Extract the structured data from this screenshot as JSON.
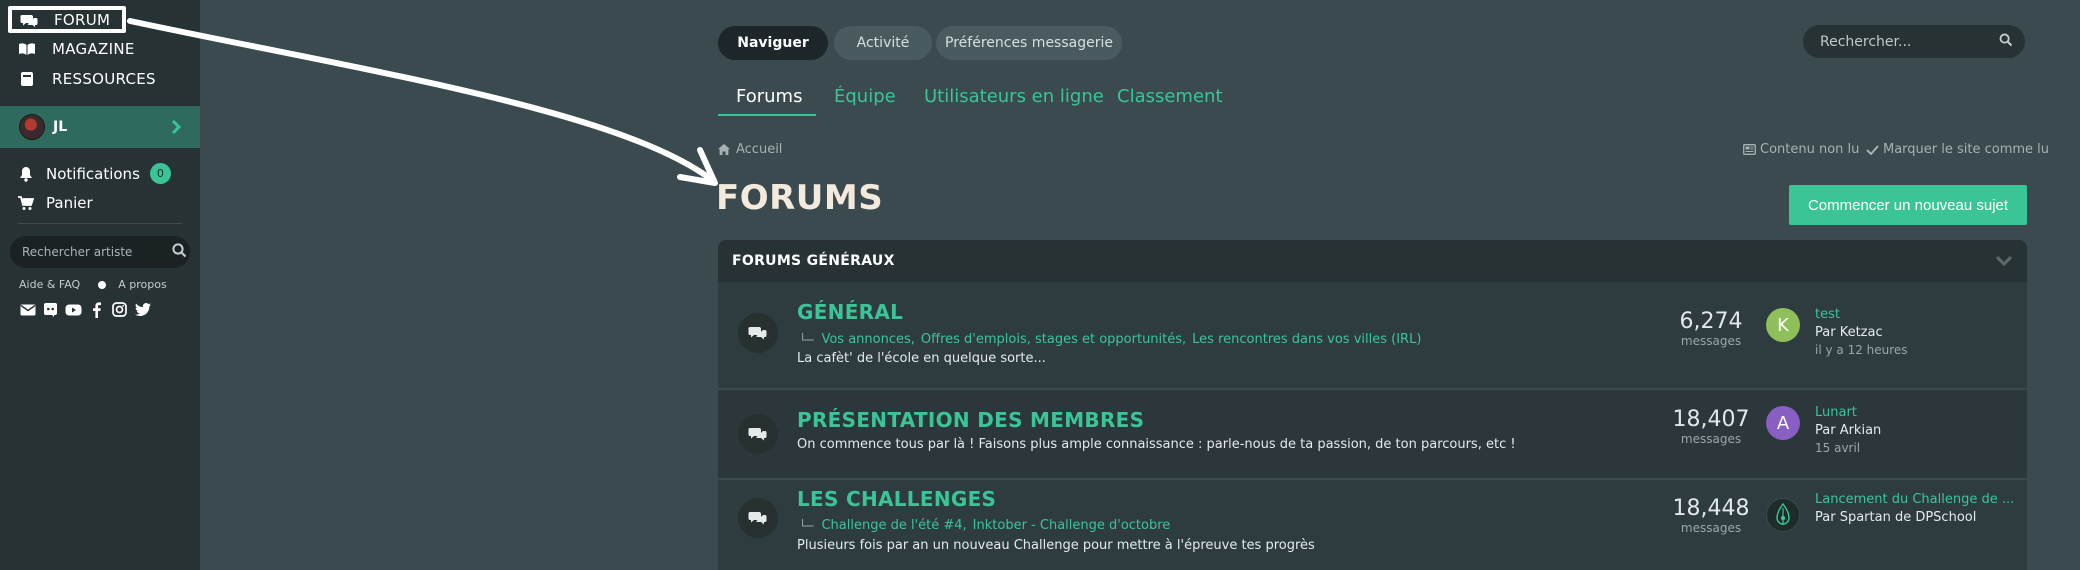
{
  "sidebar": {
    "nav": [
      "FORUM",
      "MAGAZINE",
      "RESSOURCES"
    ],
    "user": "JL",
    "notifications_label": "Notifications",
    "notifications_count": "0",
    "panier_label": "Panier",
    "artist_search_placeholder": "Rechercher artiste",
    "help_label": "Aide & FAQ",
    "about_label": "A propos",
    "social_icons": [
      "envelope-icon",
      "discord-icon",
      "youtube-icon",
      "facebook-icon",
      "instagram-icon",
      "twitter-icon"
    ]
  },
  "header": {
    "tabs": [
      "Naviguer",
      "Activité",
      "Préférences messagerie"
    ],
    "search_placeholder": "Rechercher...",
    "subtabs": [
      "Forums",
      "Équipe",
      "Utilisateurs en ligne",
      "Classement"
    ]
  },
  "breadcrumb": {
    "home": "Accueil"
  },
  "actions": {
    "unread": "Contenu non lu",
    "mark_read": "Marquer le site comme lu",
    "new_topic": "Commencer un nouveau sujet"
  },
  "page_title": "FORUMS",
  "block_title": "FORUMS GÉNÉRAUX",
  "forums": [
    {
      "title": "GÉNÉRAL",
      "subforums": [
        "Vos annonces,",
        "Offres d'emplois, stages et opportunités,",
        "Les rencontres dans vos villes (IRL)"
      ],
      "description": "La cafèt' de l'école en quelque sorte...",
      "count": "6,274",
      "count_label": "messages",
      "last_avatar_letter": "K",
      "last_avatar_color": "#8fbf5a",
      "last_title": "test",
      "last_by": "Par Ketzac",
      "last_when": "il y a 12 heures"
    },
    {
      "title": "PRÉSENTATION DES MEMBRES",
      "subforums": [],
      "description": "On commence tous par là ! Faisons plus ample connaissance : parle-nous de ta passion, de ton parcours, etc !",
      "count": "18,407",
      "count_label": "messages",
      "last_avatar_letter": "A",
      "last_avatar_color": "#8a5fc4",
      "last_title": "Lunart",
      "last_by": "Par Arkian",
      "last_when": "15 avril"
    },
    {
      "title": "LES CHALLENGES",
      "subforums": [
        "Challenge de l'été #4,",
        "Inktober - Challenge d'octobre"
      ],
      "description": "Plusieurs fois par an un nouveau Challenge pour mettre à l'épreuve tes progrès",
      "count": "18,448",
      "count_label": "messages",
      "last_avatar_letter": "",
      "last_avatar_color": "#1f2a2a",
      "last_title": "Lancement du Challenge de ...",
      "last_by": "Par Spartan de DPSchool",
      "last_when": ""
    }
  ],
  "colors": {
    "accent": "#3bc597",
    "sidebar": "#263234",
    "background": "#3a4a4e"
  }
}
